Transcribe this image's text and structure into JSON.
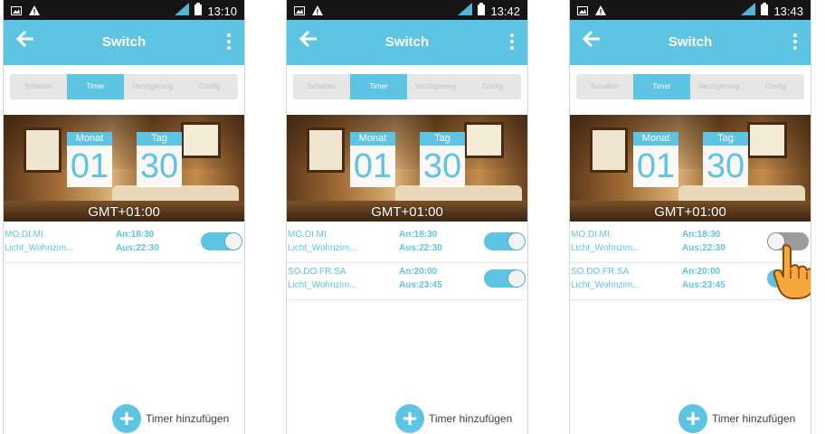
{
  "screens": [
    {
      "status": {
        "time": "13:10"
      },
      "appbar": {
        "title": "Switch"
      },
      "tabs": [
        "Schalten",
        "Timer",
        "Verzögerung",
        "Config"
      ],
      "date": {
        "month_label": "Monat",
        "month": "01",
        "day_label": "Tag",
        "day": "30",
        "timezone": "GMT+01:00"
      },
      "timers": [
        {
          "days": "MO.DI.MI.",
          "name": "Licht_Wohnzim...",
          "on": "An:18:30",
          "off": "Aus:22:30",
          "enabled": true
        }
      ],
      "add_label": "Timer hinzufügen"
    },
    {
      "status": {
        "time": "13:42"
      },
      "appbar": {
        "title": "Switch"
      },
      "tabs": [
        "Schalten",
        "Timer",
        "Verzögerung",
        "Config"
      ],
      "date": {
        "month_label": "Monat",
        "month": "01",
        "day_label": "Tag",
        "day": "30",
        "timezone": "GMT+01:00"
      },
      "timers": [
        {
          "days": "MO.DI.MI.",
          "name": "Licht_Wohnzim...",
          "on": "An:18:30",
          "off": "Aus:22:30",
          "enabled": true
        },
        {
          "days": "SO.DO.FR.SA",
          "name": "Licht_Wohnzim...",
          "on": "An:20:00",
          "off": "Aus:23:45",
          "enabled": true
        }
      ],
      "add_label": "Timer hinzufügen"
    },
    {
      "status": {
        "time": "13:43"
      },
      "appbar": {
        "title": "Switch"
      },
      "tabs": [
        "Schalten",
        "Timer",
        "Verzögerung",
        "Config"
      ],
      "date": {
        "month_label": "Monat",
        "month": "01",
        "day_label": "Tag",
        "day": "30",
        "timezone": "GMT+01:00"
      },
      "timers": [
        {
          "days": "MO.DI.MI.",
          "name": "Licht_Wohnzim...",
          "on": "An:18:30",
          "off": "Aus:22:30",
          "enabled": false
        },
        {
          "days": "SO.DO.FR.SA",
          "name": "Licht_Wohnzim...",
          "on": "An:20:00",
          "off": "Aus:23:45",
          "enabled": true
        }
      ],
      "add_label": "Timer hinzufügen"
    }
  ],
  "colors": {
    "accent": "#5ec4e3",
    "statusbar": "#151515",
    "toggle_off": "#9c9c9c",
    "hand": "#f6a93b"
  },
  "icons": {
    "back": "arrow-left-icon",
    "menu": "more-vert-icon",
    "add": "plus-circle-icon",
    "signal": "signal-icon",
    "battery": "battery-icon",
    "hand": "pointing-hand-icon"
  }
}
